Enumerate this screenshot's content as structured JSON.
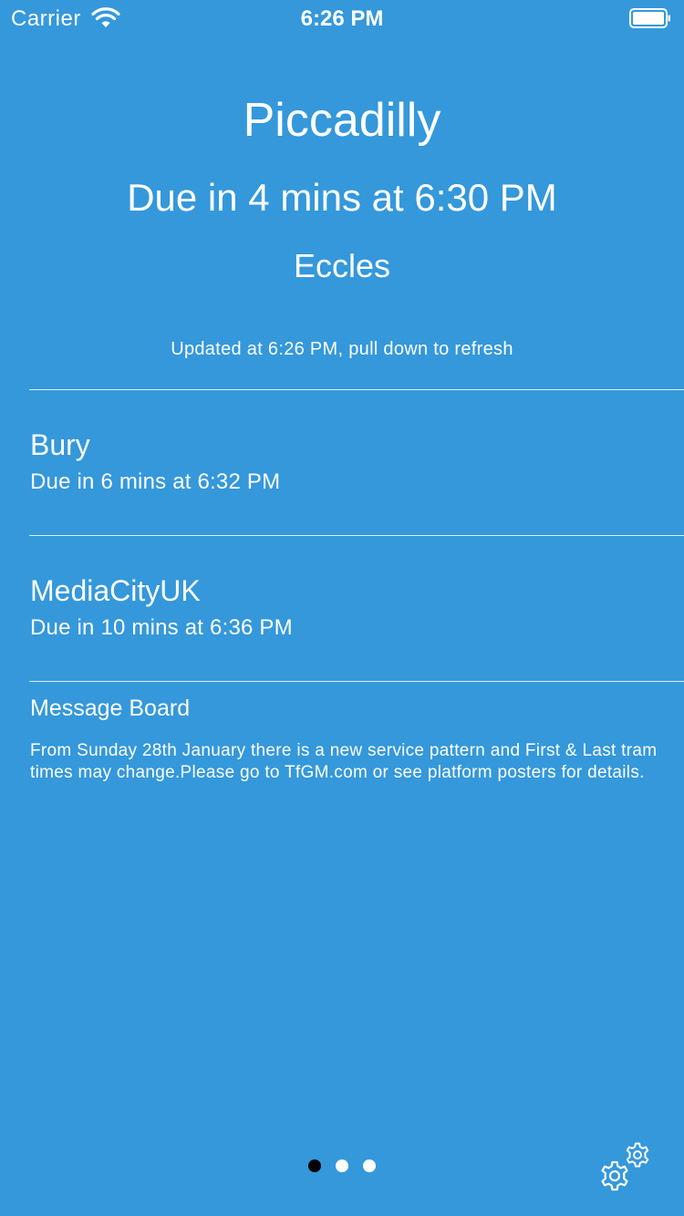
{
  "status_bar": {
    "carrier": "Carrier",
    "time": "6:26 PM",
    "wifi_icon": "wifi-icon",
    "battery_icon": "battery-icon"
  },
  "header": {
    "station": "Piccadilly",
    "next_due": "Due in 4 mins at 6:30 PM",
    "next_destination": "Eccles",
    "updated": "Updated at 6:26 PM, pull down to refresh"
  },
  "trams": [
    {
      "destination": "Bury",
      "due": "Due in 6 mins at 6:32 PM"
    },
    {
      "destination": "MediaCityUK",
      "due": "Due in 10 mins at 6:36 PM"
    }
  ],
  "message_board": {
    "title": "Message Board",
    "body": "From Sunday 28th January there is a new service pattern and First & Last tram times may change.Please go to TfGM.com or see platform posters for details."
  },
  "pager": {
    "pages": 3,
    "current_page": 1
  },
  "settings_icon": "gear-icon",
  "colors": {
    "background": "#3498db",
    "text": "#ffffff",
    "active_dot": "#000000"
  }
}
